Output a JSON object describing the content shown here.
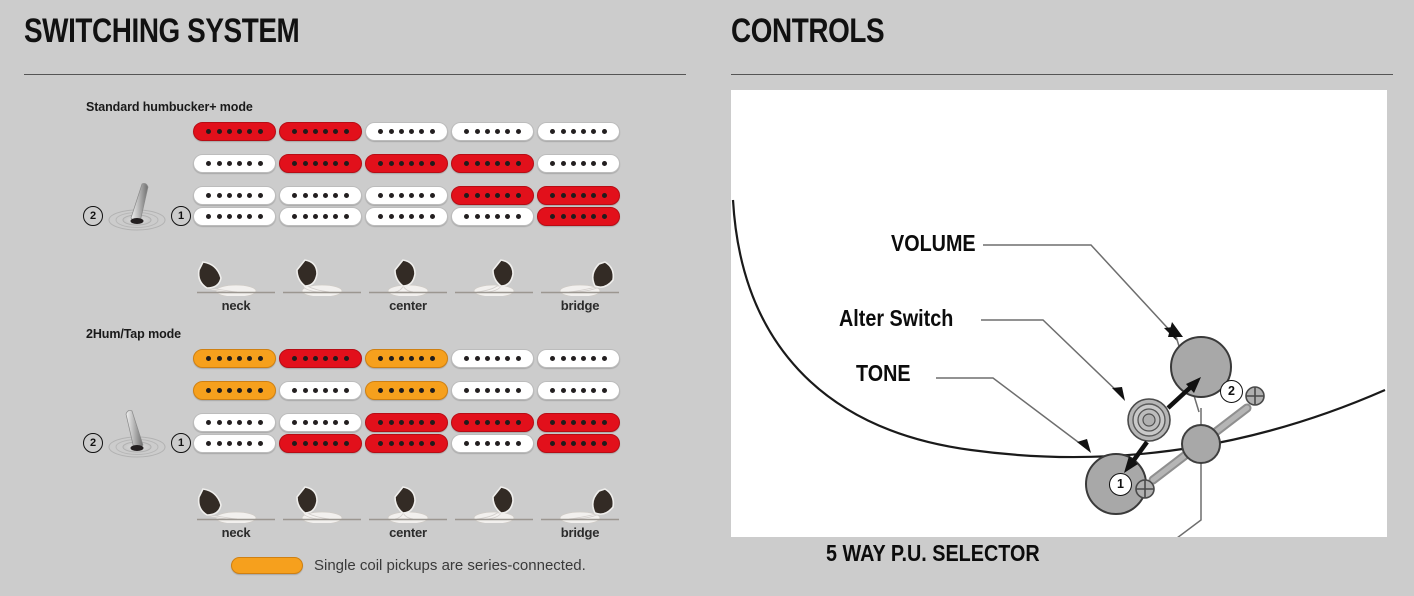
{
  "background_color": "#cccccc",
  "panels": {
    "switching": {
      "title": "SWITCHING SYSTEM",
      "modes": [
        {
          "label": "Standard humbucker+ mode",
          "switch_position": "1",
          "switch_numbers": {
            "left": "2",
            "right": "1"
          },
          "columns": [
            {
              "selector_label": "neck",
              "blade": "far-left",
              "neck_pickup": "red",
              "middle_pickup": "white",
              "bridge_top": "white",
              "bridge_bottom": "white"
            },
            {
              "selector_label": "",
              "blade": "left",
              "neck_pickup": "red",
              "middle_pickup": "red",
              "bridge_top": "white",
              "bridge_bottom": "white"
            },
            {
              "selector_label": "center",
              "blade": "center",
              "neck_pickup": "white",
              "middle_pickup": "red",
              "bridge_top": "white",
              "bridge_bottom": "white"
            },
            {
              "selector_label": "",
              "blade": "right",
              "neck_pickup": "white",
              "middle_pickup": "red",
              "bridge_top": "red",
              "bridge_bottom": "white"
            },
            {
              "selector_label": "bridge",
              "blade": "far-right",
              "neck_pickup": "white",
              "middle_pickup": "white",
              "bridge_top": "red",
              "bridge_bottom": "red"
            }
          ]
        },
        {
          "label": "2Hum/Tap mode",
          "switch_position": "2",
          "switch_numbers": {
            "left": "2",
            "right": "1"
          },
          "columns": [
            {
              "selector_label": "neck",
              "blade": "far-left",
              "neck_pickup": "orange",
              "middle_pickup": "orange",
              "bridge_top": "white",
              "bridge_bottom": "white"
            },
            {
              "selector_label": "",
              "blade": "left",
              "neck_pickup": "red",
              "middle_pickup": "white",
              "bridge_top": "white",
              "bridge_bottom": "red"
            },
            {
              "selector_label": "center",
              "blade": "center",
              "neck_pickup": "orange",
              "middle_pickup": "orange",
              "bridge_top": "red",
              "bridge_bottom": "red"
            },
            {
              "selector_label": "",
              "blade": "right",
              "neck_pickup": "white",
              "middle_pickup": "white",
              "bridge_top": "red",
              "bridge_bottom": "white"
            },
            {
              "selector_label": "bridge",
              "blade": "far-right",
              "neck_pickup": "white",
              "middle_pickup": "white",
              "bridge_top": "red",
              "bridge_bottom": "red"
            }
          ]
        }
      ],
      "legend": {
        "swatch_color": "orange",
        "text": "Single coil pickups are series-connected."
      }
    },
    "controls": {
      "title": "CONTROLS",
      "labels": {
        "volume": "VOLUME",
        "alter_switch": "Alter Switch",
        "tone": "TONE",
        "selector": "5 WAY P.U. SELECTOR"
      },
      "alter_switch_positions": {
        "up": "2",
        "down": "1"
      }
    }
  },
  "colors": {
    "red": "#e2101b",
    "orange": "#f6a01d",
    "white": "#ffffff",
    "pole": "#231f20",
    "knob_gray": "#a8a8a8",
    "board": "#ffffff"
  }
}
